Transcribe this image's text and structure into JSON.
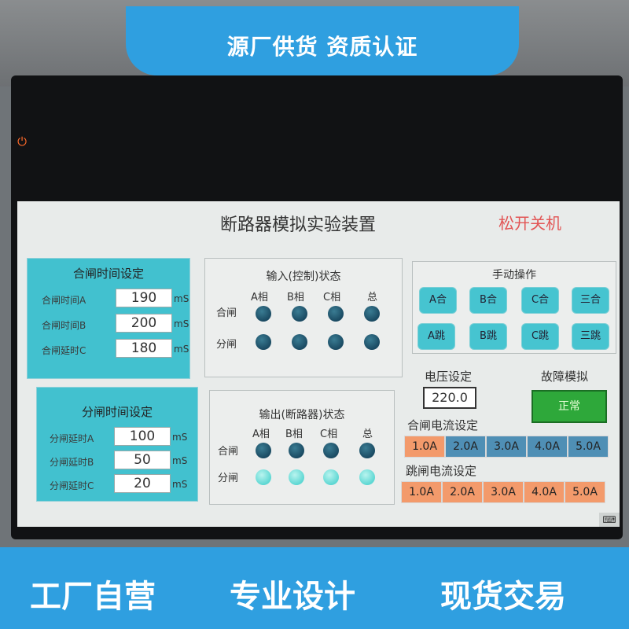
{
  "banner": {
    "text": "源厂供货 资质认证"
  },
  "footer": {
    "s1": "工厂自营",
    "s2": "专业设计",
    "s3": "现货交易"
  },
  "app": {
    "title": "断路器模拟实验装置",
    "shutdown": "松开关机"
  },
  "close_time": {
    "header": "合闸时间设定",
    "unit": "mS",
    "rows": [
      {
        "label": "合闸时间A",
        "value": "190"
      },
      {
        "label": "合闸时间B",
        "value": "200"
      },
      {
        "label": "合闸延时C",
        "value": "180"
      }
    ]
  },
  "open_time": {
    "header": "分闸时间设定",
    "unit": "mS",
    "rows": [
      {
        "label": "分闸延时A",
        "value": "100"
      },
      {
        "label": "分闸延时B",
        "value": "50"
      },
      {
        "label": "分闸延时C",
        "value": "20"
      }
    ]
  },
  "input_status": {
    "title": "输入(控制)状态",
    "cols": [
      "A相",
      "B相",
      "C相",
      "总"
    ],
    "rows": [
      "合闸",
      "分闸"
    ]
  },
  "output_status": {
    "title": "输出(断路器)状态",
    "cols": [
      "A相",
      "B相",
      "C相",
      "总"
    ],
    "rows": [
      "合闸",
      "分闸"
    ]
  },
  "manual": {
    "title": "手动操作",
    "row1": [
      "A合",
      "B合",
      "C合",
      "三合"
    ],
    "row2": [
      "A跳",
      "B跳",
      "C跳",
      "三跳"
    ]
  },
  "voltage": {
    "label": "电压设定",
    "value": "220.0"
  },
  "fault": {
    "label": "故障模拟",
    "value": "正常"
  },
  "close_current": {
    "label": "合闸电流设定",
    "options": [
      "1.0A",
      "2.0A",
      "3.0A",
      "4.0A",
      "5.0A"
    ],
    "selected": "1.0A"
  },
  "trip_current": {
    "label": "跳闸电流设定",
    "options": [
      "1.0A",
      "2.0A",
      "3.0A",
      "4.0A",
      "5.0A"
    ]
  },
  "colors": {
    "accent": "#2f9fe0",
    "panel": "#42c1cf",
    "fault_green": "#2ea83a",
    "selected_cell": "#f39a6b",
    "cell_blue": "#4f8fb5"
  }
}
